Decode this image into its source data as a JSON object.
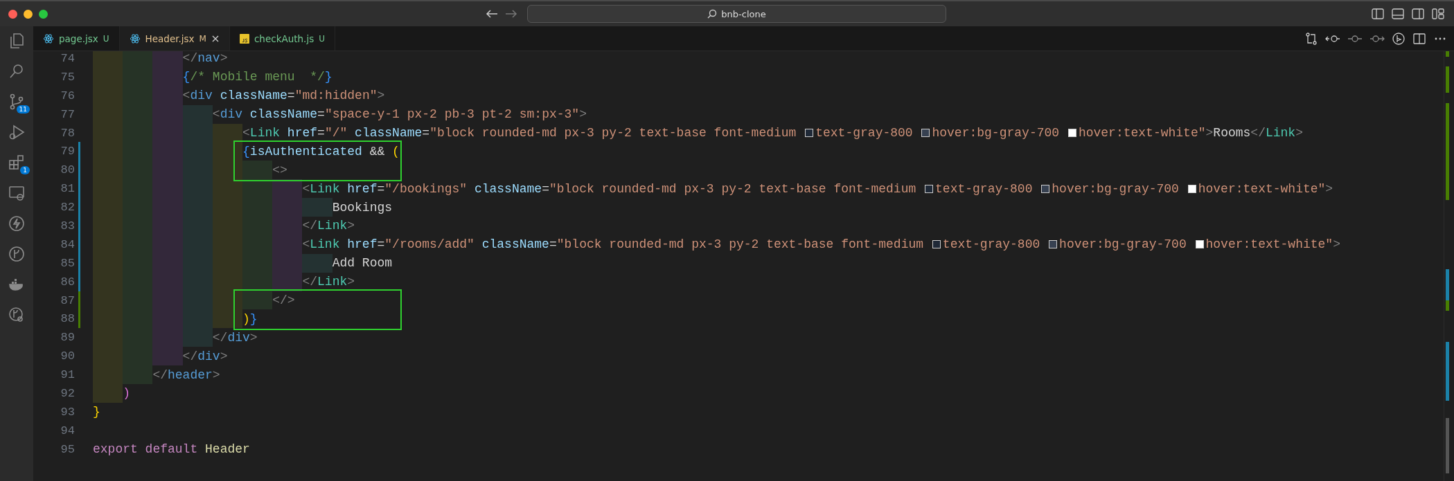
{
  "window": {
    "title": "bnb-clone"
  },
  "activity_bar": [
    {
      "kind": "files",
      "selected": false
    },
    {
      "kind": "search",
      "selected": false
    },
    {
      "kind": "source-control",
      "badge": "11",
      "selected": false
    },
    {
      "kind": "run-debug",
      "selected": false
    },
    {
      "kind": "extensions",
      "badge": "1",
      "selected": false
    },
    {
      "kind": "remote",
      "selected": false
    },
    {
      "kind": "bolt",
      "selected": false
    },
    {
      "kind": "branch",
      "selected": false
    },
    {
      "kind": "docker",
      "selected": false
    },
    {
      "kind": "branch-search",
      "selected": false
    }
  ],
  "tabs": [
    {
      "label": "page.jsx",
      "status": "U",
      "kind": "react",
      "selected": false
    },
    {
      "label": "Header.jsx",
      "status": "M",
      "kind": "react",
      "selected": true
    },
    {
      "label": "checkAuth.js",
      "status": "U",
      "kind": "js",
      "selected": false
    }
  ],
  "lines": [
    {
      "children": [
        {
          "children": [
            {
              "children": [
                {
                  "number": "74",
                  "tokens": [
                    {
                      "kind": "punct",
                      "text": "</"
                    },
                    {
                      "kind": "tag",
                      "text": "nav"
                    },
                    {
                      "kind": "punct",
                      "text": ">"
                    }
                  ]
                },
                {
                  "number": "75",
                  "tokens": [
                    {
                      "kind": "bracket",
                      "text": "{",
                      "color": "#3794ff"
                    },
                    {
                      "kind": "comment",
                      "text": "/* Mobile menu  */"
                    },
                    {
                      "kind": "bracket",
                      "text": "}",
                      "color": "#3794ff"
                    }
                  ]
                },
                {
                  "number": "76",
                  "tokens": [
                    {
                      "kind": "punct",
                      "text": "<"
                    },
                    {
                      "kind": "tag",
                      "text": "div"
                    },
                    {
                      "kind": "attr",
                      "text": " className"
                    },
                    {
                      "kind": "plain",
                      "text": "="
                    },
                    {
                      "kind": "string",
                      "text": "\"md:hidden\""
                    },
                    {
                      "kind": "punct",
                      "text": ">"
                    }
                  ],
                  "children": [
                    {
                      "number": "77",
                      "tokens": [
                        {
                          "kind": "punct",
                          "text": "<"
                        },
                        {
                          "kind": "tag",
                          "text": "div"
                        },
                        {
                          "kind": "attr",
                          "text": " className"
                        },
                        {
                          "kind": "plain",
                          "text": "="
                        },
                        {
                          "kind": "string",
                          "text": "\"space-y-1 px-2 pb-3 pt-2 sm:px-3\""
                        },
                        {
                          "kind": "punct",
                          "text": ">"
                        }
                      ],
                      "children": [
                        {
                          "number": "78",
                          "tokens": [
                            {
                              "kind": "punct",
                              "text": "<"
                            },
                            {
                              "kind": "component",
                              "text": "Link"
                            },
                            {
                              "kind": "attr",
                              "text": " href"
                            },
                            {
                              "kind": "plain",
                              "text": "="
                            },
                            {
                              "kind": "string",
                              "text": "\"/\""
                            },
                            {
                              "kind": "attr",
                              "text": " className"
                            },
                            {
                              "kind": "plain",
                              "text": "="
                            },
                            {
                              "kind": "string",
                              "text": "\"block rounded-md px-3 py-2 text-base font-medium "
                            },
                            {
                              "kind": "swatch",
                              "color": "#1f2937"
                            },
                            {
                              "kind": "string",
                              "text": "text-gray-800 "
                            },
                            {
                              "kind": "swatch",
                              "color": "#374151"
                            },
                            {
                              "kind": "string",
                              "text": "hover:bg-gray-700 "
                            },
                            {
                              "kind": "swatch",
                              "color": "#ffffff"
                            },
                            {
                              "kind": "string",
                              "text": "hover:text-white\""
                            },
                            {
                              "kind": "punct",
                              "text": ">"
                            },
                            {
                              "kind": "plain",
                              "text": "Rooms"
                            },
                            {
                              "kind": "punct",
                              "text": "</"
                            },
                            {
                              "kind": "component",
                              "text": "Link"
                            },
                            {
                              "kind": "punct",
                              "text": ">"
                            }
                          ]
                        },
                        {
                          "number": "79",
                          "color": "#1b81a8",
                          "highlight": true,
                          "tokens": [
                            {
                              "kind": "bracket",
                              "text": "{",
                              "color": "#3794ff"
                            },
                            {
                              "kind": "attr",
                              "text": "isAuthenticated"
                            },
                            {
                              "kind": "plain",
                              "text": " && "
                            },
                            {
                              "kind": "bracket",
                              "text": "(",
                              "color": "#ffd700"
                            }
                          ],
                          "children": [
                            {
                              "number": "80",
                              "color": "#1b81a8",
                              "highlight": true,
                              "tokens": [
                                {
                                  "kind": "punct",
                                  "text": "<>"
                                }
                              ],
                              "children": [
                                {
                                  "number": "81",
                                  "color": "#1b81a8",
                                  "tokens": [
                                    {
                                      "kind": "punct",
                                      "text": "<"
                                    },
                                    {
                                      "kind": "component",
                                      "text": "Link"
                                    },
                                    {
                                      "kind": "attr",
                                      "text": " href"
                                    },
                                    {
                                      "kind": "plain",
                                      "text": "="
                                    },
                                    {
                                      "kind": "string",
                                      "text": "\"/bookings\""
                                    },
                                    {
                                      "kind": "attr",
                                      "text": " className"
                                    },
                                    {
                                      "kind": "plain",
                                      "text": "="
                                    },
                                    {
                                      "kind": "string",
                                      "text": "\"block rounded-md px-3 py-2 text-base font-medium "
                                    },
                                    {
                                      "kind": "swatch",
                                      "color": "#1f2937"
                                    },
                                    {
                                      "kind": "string",
                                      "text": "text-gray-800 "
                                    },
                                    {
                                      "kind": "swatch",
                                      "color": "#374151"
                                    },
                                    {
                                      "kind": "string",
                                      "text": "hover:bg-gray-700 "
                                    },
                                    {
                                      "kind": "swatch",
                                      "color": "#ffffff"
                                    },
                                    {
                                      "kind": "string",
                                      "text": "hover:text-white\""
                                    },
                                    {
                                      "kind": "punct",
                                      "text": ">"
                                    }
                                  ],
                                  "children": [
                                    {
                                      "number": "82",
                                      "color": "#1b81a8",
                                      "tokens": [
                                        {
                                          "kind": "plain",
                                          "text": "Bookings"
                                        }
                                      ]
                                    }
                                  ]
                                },
                                {
                                  "number": "83",
                                  "color": "#1b81a8",
                                  "tokens": [
                                    {
                                      "kind": "punct",
                                      "text": "</"
                                    },
                                    {
                                      "kind": "component",
                                      "text": "Link"
                                    },
                                    {
                                      "kind": "punct",
                                      "text": ">"
                                    }
                                  ]
                                },
                                {
                                  "number": "84",
                                  "color": "#1b81a8",
                                  "tokens": [
                                    {
                                      "kind": "punct",
                                      "text": "<"
                                    },
                                    {
                                      "kind": "component",
                                      "text": "Link"
                                    },
                                    {
                                      "kind": "attr",
                                      "text": " href"
                                    },
                                    {
                                      "kind": "plain",
                                      "text": "="
                                    },
                                    {
                                      "kind": "string",
                                      "text": "\"/rooms/add\""
                                    },
                                    {
                                      "kind": "attr",
                                      "text": " className"
                                    },
                                    {
                                      "kind": "plain",
                                      "text": "="
                                    },
                                    {
                                      "kind": "string",
                                      "text": "\"block rounded-md px-3 py-2 text-base font-medium "
                                    },
                                    {
                                      "kind": "swatch",
                                      "color": "#1f2937"
                                    },
                                    {
                                      "kind": "string",
                                      "text": "text-gray-800 "
                                    },
                                    {
                                      "kind": "swatch",
                                      "color": "#374151"
                                    },
                                    {
                                      "kind": "string",
                                      "text": "hover:bg-gray-700 "
                                    },
                                    {
                                      "kind": "swatch",
                                      "color": "#ffffff"
                                    },
                                    {
                                      "kind": "string",
                                      "text": "hover:text-white\""
                                    },
                                    {
                                      "kind": "punct",
                                      "text": ">"
                                    }
                                  ],
                                  "children": [
                                    {
                                      "number": "85",
                                      "color": "#1b81a8",
                                      "tokens": [
                                        {
                                          "kind": "plain",
                                          "text": "Add Room"
                                        }
                                      ]
                                    }
                                  ]
                                },
                                {
                                  "number": "86",
                                  "color": "#1b81a8",
                                  "tokens": [
                                    {
                                      "kind": "punct",
                                      "text": "</"
                                    },
                                    {
                                      "kind": "component",
                                      "text": "Link"
                                    },
                                    {
                                      "kind": "punct",
                                      "text": ">"
                                    }
                                  ]
                                }
                              ]
                            },
                            {
                              "number": "87",
                              "color": "#487e02",
                              "highlight": true,
                              "tokens": [
                                {
                                  "kind": "punct",
                                  "text": "</>"
                                }
                              ]
                            }
                          ]
                        },
                        {
                          "number": "88",
                          "color": "#487e02",
                          "highlight": true,
                          "tokens": [
                            {
                              "kind": "bracket",
                              "text": ")",
                              "color": "#ffd700"
                            },
                            {
                              "kind": "bracket",
                              "text": "}",
                              "color": "#3794ff"
                            }
                          ]
                        }
                      ]
                    },
                    {
                      "number": "89",
                      "tokens": [
                        {
                          "kind": "punct",
                          "text": "</"
                        },
                        {
                          "kind": "tag",
                          "text": "div"
                        },
                        {
                          "kind": "punct",
                          "text": ">"
                        }
                      ]
                    }
                  ]
                },
                {
                  "number": "90",
                  "tokens": [
                    {
                      "kind": "punct",
                      "text": "</"
                    },
                    {
                      "kind": "tag",
                      "text": "div"
                    },
                    {
                      "kind": "punct",
                      "text": ">"
                    }
                  ]
                }
              ]
            },
            {
              "number": "91",
              "tokens": [
                {
                  "kind": "punct",
                  "text": "</"
                },
                {
                  "kind": "tag",
                  "text": "header"
                },
                {
                  "kind": "punct",
                  "text": ">"
                }
              ]
            }
          ]
        },
        {
          "number": "92",
          "tokens": [
            {
              "kind": "bracket",
              "text": ")",
              "color": "#da70d6"
            }
          ]
        }
      ]
    },
    {
      "number": "93",
      "tokens": [
        {
          "kind": "bracket",
          "text": "}",
          "color": "#ffd700"
        }
      ]
    },
    {
      "number": "94"
    },
    {
      "number": "95",
      "tokens": [
        {
          "kind": "keyword",
          "text": "export default"
        },
        {
          "kind": "function",
          "text": " Header"
        }
      ]
    }
  ]
}
